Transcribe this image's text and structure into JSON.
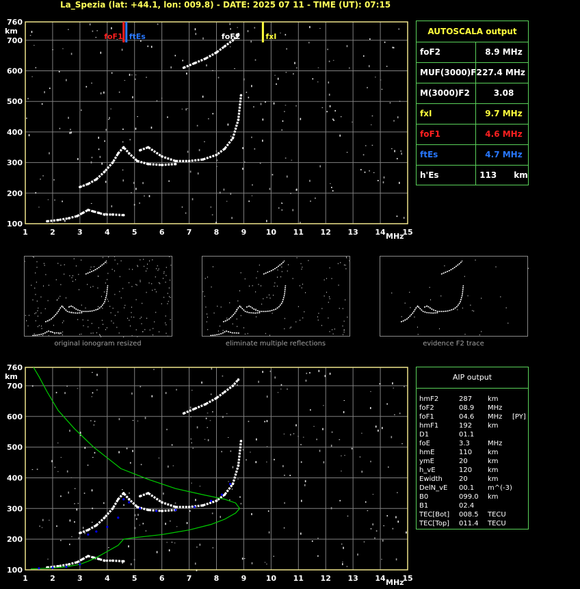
{
  "title": "La_Spezia (lat: +44.1, lon: 009.8) - DATE: 2025 07 11 - TIME (UT): 07:15",
  "colors": {
    "axis": "#f0e68c",
    "grid": "#808080",
    "trace": "#ffffff",
    "fit": "#00d000",
    "profile": "#0000ff",
    "red": "#ff2020",
    "blue": "#2878ff",
    "yellow": "#ffff3c",
    "box": "#5ad25a"
  },
  "chart_data": [
    {
      "type": "scatter",
      "name": "ionogram",
      "title": "",
      "xlabel": "MHz",
      "ylabel": "km",
      "xlim": [
        1,
        15
      ],
      "ylim": [
        100,
        760
      ],
      "xticks": [
        "1",
        "2",
        "3",
        "4",
        "5",
        "6",
        "7",
        "8",
        "9",
        "10",
        "11",
        "12",
        "13",
        "14",
        "15"
      ],
      "yticks": [
        "100",
        "200",
        "300",
        "400",
        "500",
        "600",
        "700",
        "760"
      ],
      "grid": true,
      "markers": [
        {
          "label": "foF1",
          "x": 4.6,
          "color": "red"
        },
        {
          "label": "ftEs",
          "x": 4.7,
          "color": "blue"
        },
        {
          "label": "foF2",
          "x": 8.9,
          "color": "white"
        },
        {
          "label": "fxI",
          "x": 9.7,
          "color": "yellow"
        }
      ],
      "traces": [
        {
          "name": "E",
          "x": [
            1.8,
            2.2,
            2.6,
            2.9,
            3.1,
            3.3,
            3.5,
            3.7,
            3.9,
            4.2,
            4.6
          ],
          "y": [
            108,
            112,
            118,
            125,
            135,
            145,
            140,
            135,
            130,
            130,
            128
          ]
        },
        {
          "name": "F1",
          "x": [
            3.0,
            3.3,
            3.6,
            3.9,
            4.2,
            4.4,
            4.6,
            4.8,
            5.1,
            5.5,
            6.0,
            6.5
          ],
          "y": [
            220,
            230,
            245,
            270,
            300,
            330,
            350,
            330,
            305,
            295,
            292,
            295
          ]
        },
        {
          "name": "F2",
          "x": [
            5.2,
            5.5,
            6.0,
            6.5,
            7.0,
            7.5,
            8.0,
            8.3,
            8.6,
            8.8,
            8.9
          ],
          "y": [
            340,
            350,
            320,
            305,
            305,
            310,
            325,
            345,
            380,
            440,
            520
          ]
        },
        {
          "name": "F2-second",
          "x": [
            6.8,
            7.2,
            7.6,
            8.0,
            8.3,
            8.6,
            8.8
          ],
          "y": [
            610,
            625,
            640,
            660,
            680,
            700,
            720
          ]
        }
      ]
    },
    {
      "type": "scatter",
      "name": "ionogram-aip",
      "title": "",
      "xlabel": "MHz",
      "ylabel": "km",
      "xlim": [
        1,
        15
      ],
      "ylim": [
        100,
        760
      ],
      "xticks": [
        "1",
        "2",
        "3",
        "4",
        "5",
        "6",
        "7",
        "8",
        "9",
        "10",
        "11",
        "12",
        "13",
        "14",
        "15"
      ],
      "yticks": [
        "100",
        "200",
        "300",
        "400",
        "500",
        "600",
        "700",
        "760"
      ],
      "grid": true,
      "traces": [
        {
          "name": "E",
          "x": [
            1.8,
            2.2,
            2.6,
            2.9,
            3.1,
            3.3,
            3.5,
            3.7,
            3.9,
            4.2,
            4.6
          ],
          "y": [
            108,
            112,
            118,
            125,
            135,
            145,
            140,
            135,
            130,
            130,
            128
          ]
        },
        {
          "name": "F1",
          "x": [
            3.0,
            3.3,
            3.6,
            3.9,
            4.2,
            4.4,
            4.6,
            4.8,
            5.1,
            5.5,
            6.0,
            6.5
          ],
          "y": [
            220,
            230,
            245,
            270,
            300,
            330,
            350,
            330,
            305,
            295,
            292,
            295
          ]
        },
        {
          "name": "F2",
          "x": [
            5.2,
            5.5,
            6.0,
            6.5,
            7.0,
            7.5,
            8.0,
            8.3,
            8.6,
            8.8,
            8.9
          ],
          "y": [
            340,
            350,
            320,
            305,
            305,
            310,
            325,
            345,
            380,
            440,
            520
          ]
        },
        {
          "name": "F2-second",
          "x": [
            6.8,
            7.2,
            7.6,
            8.0,
            8.3,
            8.6,
            8.8
          ],
          "y": [
            610,
            625,
            640,
            660,
            680,
            700,
            720
          ]
        }
      ],
      "fit_curve": {
        "x": [
          1.2,
          1.5,
          2.0,
          2.5,
          3.0,
          3.3,
          3.6,
          4.0,
          4.4,
          4.6,
          5.0,
          6.0,
          7.0,
          7.8,
          8.3,
          8.7,
          8.85,
          8.7,
          8.3,
          7.5,
          6.5,
          5.5,
          4.5,
          3.5,
          2.8,
          2.2,
          1.8,
          1.5,
          1.3
        ],
        "y": [
          103,
          104,
          106,
          110,
          118,
          128,
          140,
          160,
          180,
          200,
          205,
          215,
          230,
          248,
          265,
          285,
          300,
          318,
          330,
          345,
          365,
          395,
          430,
          500,
          560,
          620,
          680,
          730,
          760
        ]
      },
      "profile_points": {
        "x": [
          1.5,
          2.0,
          2.5,
          3.0,
          3.3,
          3.6,
          4.0,
          4.4,
          4.6,
          4.8,
          5.2,
          5.8,
          6.5,
          7.2,
          7.8,
          8.2,
          8.5
        ],
        "y": [
          105,
          107,
          110,
          118,
          215,
          225,
          240,
          270,
          330,
          320,
          300,
          292,
          295,
          305,
          325,
          345,
          380
        ]
      }
    }
  ],
  "autoscala": {
    "header": "AUTOSCALA output",
    "rows": [
      {
        "key": "foF2",
        "value": "8.9 MHz",
        "color": "#ffffff"
      },
      {
        "key": "MUF(3000)F2",
        "value": "27.4 MHz",
        "color": "#ffffff"
      },
      {
        "key": "M(3000)F2",
        "value": "3.08",
        "color": "#ffffff"
      },
      {
        "key": "fxI",
        "value": "9.7 MHz",
        "color": "#ffff3c"
      },
      {
        "key": "foF1",
        "value": "4.6 MHz",
        "color": "#ff2020"
      },
      {
        "key": "ftEs",
        "value": "4.7 MHz",
        "color": "#2878ff"
      },
      {
        "key": "h'Es",
        "value": "113",
        "unit": "km",
        "color": "#ffffff"
      }
    ]
  },
  "thumbs": [
    {
      "caption": "original ionogram resized"
    },
    {
      "caption": "eliminate multiple reflections"
    },
    {
      "caption": "evidence F2 trace"
    }
  ],
  "aip": {
    "header": "AIP output",
    "rows": [
      [
        "hmF2",
        "287",
        "km",
        ""
      ],
      [
        "foF2",
        "08.9",
        "MHz",
        ""
      ],
      [
        "foF1",
        "04.6",
        "MHz",
        "[PY]"
      ],
      [
        "hmF1",
        "192",
        "km",
        ""
      ],
      [
        "D1",
        "01.1",
        "",
        ""
      ],
      [
        "foE",
        "3.3",
        "MHz",
        ""
      ],
      [
        "hmE",
        "110",
        "km",
        ""
      ],
      [
        "ymE",
        "20",
        "km",
        ""
      ],
      [
        "h_vE",
        "120",
        "km",
        ""
      ],
      [
        "Ewidth",
        "20",
        "km",
        ""
      ],
      [
        "DelN_vE",
        "00.1",
        "m^(-3)",
        ""
      ],
      [
        "B0",
        "099.0",
        "km",
        ""
      ],
      [
        "B1",
        "02.4",
        "",
        ""
      ],
      [
        "TEC[Bot]",
        "008.5",
        "TECU",
        ""
      ],
      [
        "TEC[Top]",
        "011.4",
        "TECU",
        ""
      ]
    ]
  }
}
